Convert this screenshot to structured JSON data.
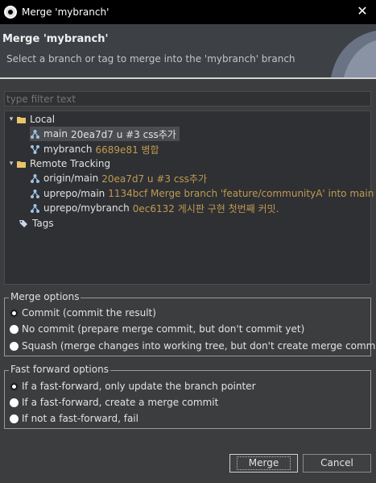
{
  "window": {
    "title": "Merge 'mybranch'"
  },
  "header": {
    "title": "Merge 'mybranch'",
    "description": "Select a branch or tag to merge into the 'mybranch' branch"
  },
  "filter": {
    "placeholder": "type filter text",
    "value": ""
  },
  "tree": {
    "local_label": "Local",
    "local_items": [
      {
        "name": "main",
        "commit": "20ea7d7 u #3 css추가",
        "icon": "branch-icon",
        "selected": true
      },
      {
        "name": "mybranch",
        "commit": "6689e81 병합",
        "icon": "current-branch-icon",
        "selected": false
      }
    ],
    "remote_label": "Remote Tracking",
    "remote_items": [
      {
        "name": "origin/main",
        "commit": "20ea7d7 u #3 css추가",
        "icon": "branch-icon"
      },
      {
        "name": "uprepo/main",
        "commit": "1134bcf Merge branch 'feature/communityA' into main",
        "icon": "branch-icon"
      },
      {
        "name": "uprepo/mybranch",
        "commit": "0ec6132 게시판 구현 첫번째 커밋.",
        "icon": "branch-icon"
      }
    ],
    "tags_label": "Tags"
  },
  "merge_options": {
    "legend": "Merge options",
    "options": [
      {
        "label": "Commit (commit the result)",
        "checked": true
      },
      {
        "label": "No commit (prepare merge commit, but don't commit yet)",
        "checked": false
      },
      {
        "label": "Squash (merge changes into working tree, but don't create merge commit)",
        "checked": false
      }
    ]
  },
  "ff_options": {
    "legend": "Fast forward options",
    "options": [
      {
        "label": "If a fast-forward, only update the branch pointer",
        "checked": true
      },
      {
        "label": "If a fast-forward, create a merge commit",
        "checked": false
      },
      {
        "label": "If not a fast-forward, fail",
        "checked": false
      }
    ]
  },
  "buttons": {
    "merge": "Merge",
    "cancel": "Cancel"
  },
  "colors": {
    "commit_text": "#c19a52",
    "background": "#3b3d3f",
    "tree_bg": "#2e3033"
  }
}
